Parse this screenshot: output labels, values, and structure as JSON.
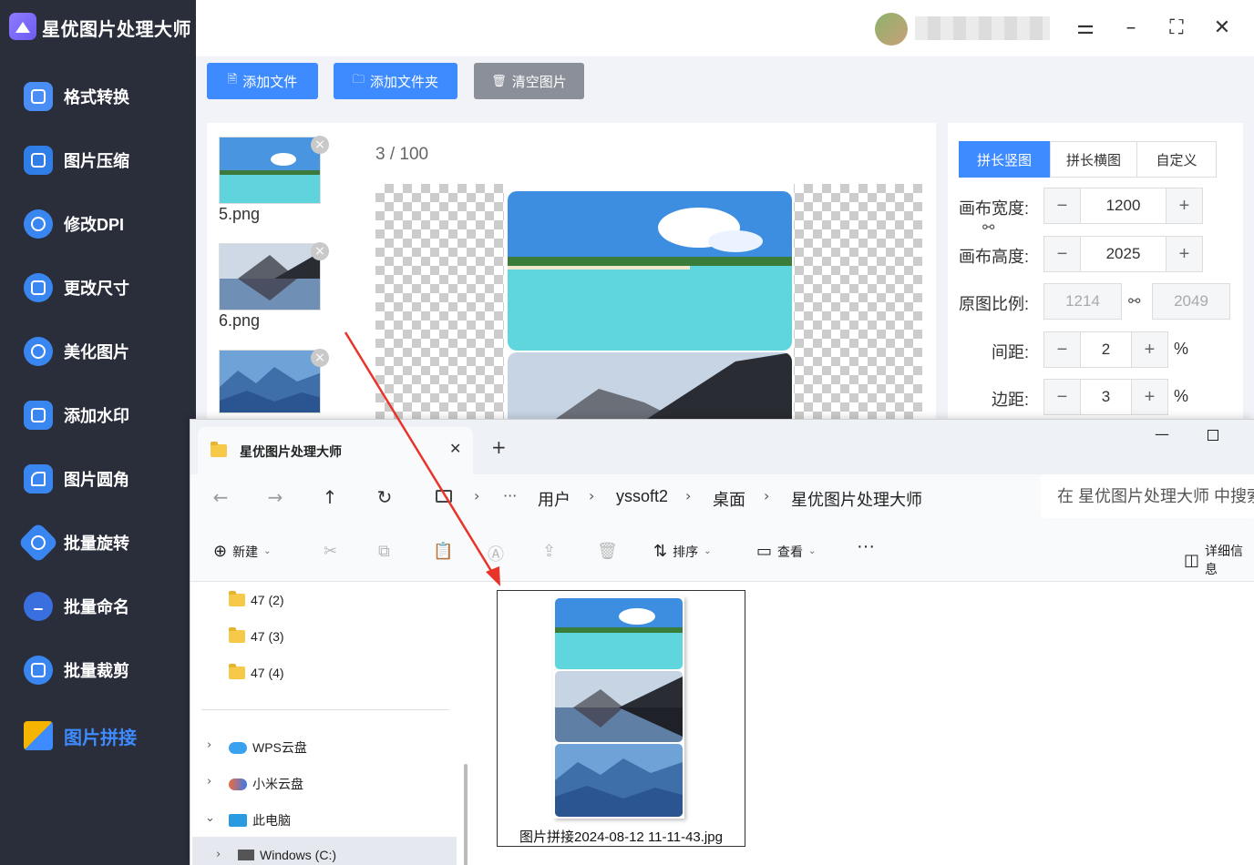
{
  "app": {
    "title": "星优图片处理大师",
    "nav": [
      {
        "label": "格式转换",
        "icon": "format-convert-icon",
        "color": "#3d8bff"
      },
      {
        "label": "图片压缩",
        "icon": "compress-icon",
        "color": "#3d8bff"
      },
      {
        "label": "修改DPI",
        "icon": "dpi-icon",
        "color": "#3d8bff"
      },
      {
        "label": "更改尺寸",
        "icon": "resize-icon",
        "color": "#3d8bff"
      },
      {
        "label": "美化图片",
        "icon": "beautify-icon",
        "color": "#3d8bff"
      },
      {
        "label": "添加水印",
        "icon": "watermark-icon",
        "color": "#3d8bff"
      },
      {
        "label": "图片圆角",
        "icon": "rounded-corner-icon",
        "color": "#3d8bff"
      },
      {
        "label": "批量旋转",
        "icon": "rotate-icon",
        "color": "#3d8bff"
      },
      {
        "label": "批量命名",
        "icon": "rename-icon",
        "color": "#3d8bff"
      },
      {
        "label": "批量裁剪",
        "icon": "crop-icon",
        "color": "#3d8bff"
      },
      {
        "label": "图片拼接",
        "icon": "puzzle-icon",
        "color": "#3d8bff",
        "active": true
      }
    ],
    "toolbar": {
      "add_file": "添加文件",
      "add_folder": "添加文件夹",
      "clear": "清空图片"
    },
    "thumbnails": [
      {
        "name": "5.png"
      },
      {
        "name": "6.png"
      },
      {
        "name": ""
      }
    ],
    "counter": {
      "current": "3",
      "sep": " / ",
      "total": "100"
    },
    "settings": {
      "tabs": [
        "拼长竖图",
        "拼长横图",
        "自定义"
      ],
      "width_label": "画布宽度:",
      "width_value": "1200",
      "height_label": "画布高度:",
      "height_value": "2025",
      "ratio_label": "原图比例:",
      "ratio_w": "1214",
      "ratio_h": "2049",
      "spacing_label": "间距:",
      "spacing_value": "2",
      "margin_label": "边距:",
      "margin_value": "3",
      "percent": "%"
    },
    "accent": "#3d8bff",
    "sidebar_bg": "#2a2e3b"
  },
  "explorer": {
    "tab_title": "星优图片处理大师",
    "breadcrumb": [
      "用户",
      "yssoft2",
      "桌面",
      "星优图片处理大师"
    ],
    "search_placeholder": "在 星优图片处理大师 中搜索",
    "commands": {
      "new": "新建",
      "sort": "排序",
      "view": "查看",
      "details": "详细信息"
    },
    "tree": [
      {
        "label": "47 (2)"
      },
      {
        "label": "47 (3)"
      },
      {
        "label": "47 (4)"
      },
      {
        "label": "WPS云盘"
      },
      {
        "label": "小米云盘"
      },
      {
        "label": "此电脑"
      },
      {
        "label": "Windows (C:)"
      }
    ],
    "file": {
      "name": "图片拼接2024-08-12 11-11-43.jpg"
    }
  }
}
